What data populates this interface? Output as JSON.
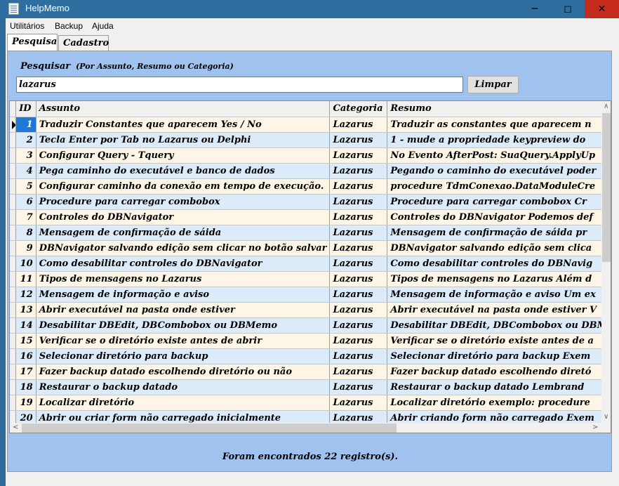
{
  "window": {
    "title": "HelpMemo"
  },
  "menu": [
    "Utilitários",
    "Backup",
    "Ajuda"
  ],
  "tabs": [
    "Pesquisa",
    "Cadastro"
  ],
  "search": {
    "label": "Pesquisar",
    "hint": "(Por Assunto, Resumo ou Categoria)",
    "value": "lazarus",
    "clear_label": "Limpar"
  },
  "grid": {
    "columns": [
      "ID",
      "Assunto",
      "Categoria",
      "Resumo"
    ],
    "rows": [
      [
        "1",
        "Traduzir Constantes que aparecem Yes / No",
        "Lazarus",
        "Traduzir as constantes que aparecem n"
      ],
      [
        "2",
        "Tecla Enter por Tab no Lazarus ou Delphi",
        "Lazarus",
        "1 -  mude a propriedade keypreview do"
      ],
      [
        "3",
        "Configurar Query - Tquery",
        "Lazarus",
        "No Evento AfterPost:  SuaQuery.ApplyUp"
      ],
      [
        "4",
        "Pega caminho do executável e banco de dados",
        "Lazarus",
        "Pegando o caminho do executável poder"
      ],
      [
        "5",
        "Configurar caminho da conexão em tempo de execução.",
        "Lazarus",
        "procedure TdmConexao.DataModuleCre"
      ],
      [
        "6",
        "Procedure para carregar combobox",
        "Lazarus",
        "Procedure para carregar combobox  Cr"
      ],
      [
        "7",
        "Controles do DBNavigator",
        "Lazarus",
        "Controles do DBNavigator  Podemos def"
      ],
      [
        "8",
        "Mensagem de confirmação de sáida",
        "Lazarus",
        "Mensagem de confirmação de sáida  pr"
      ],
      [
        "9",
        "DBNavigator salvando edição sem clicar no botão salvar",
        "Lazarus",
        "DBNavigator salvando edição sem clica"
      ],
      [
        "10",
        "Como desabilitar controles do DBNavigator",
        "Lazarus",
        "Como desabilitar controles do DBNavig"
      ],
      [
        "11",
        "Tipos de mensagens no Lazarus",
        "Lazarus",
        "Tipos de mensagens no Lazarus  Além d"
      ],
      [
        "12",
        "Mensagem de informação e aviso",
        "Lazarus",
        "Mensagem de informação e aviso  Um ex"
      ],
      [
        "13",
        "Abrir executável na pasta onde estiver",
        "Lazarus",
        "Abrir executável na pasta onde estiver V"
      ],
      [
        "14",
        "Desabilitar DBEdit, DBCombobox ou DBMemo",
        "Lazarus",
        "Desabilitar DBEdit, DBCombobox ou DBM"
      ],
      [
        "15",
        "Verificar se o diretório existe antes de abrir",
        "Lazarus",
        "Verificar se o diretório existe antes de a"
      ],
      [
        "16",
        "Selecionar diretório para backup",
        "Lazarus",
        "Selecionar diretório para backup  Exem"
      ],
      [
        "17",
        "Fazer backup datado escolhendo diretório ou não",
        "Lazarus",
        "Fazer backup datado escolhendo diretó"
      ],
      [
        "18",
        "Restaurar  o backup datado",
        "Lazarus",
        "Restaurar  o backup datado  Lembrand"
      ],
      [
        "19",
        "Localizar diretório",
        "Lazarus",
        "Localizar diretório exemplo:  procedure"
      ],
      [
        "20",
        "Abrir ou criar form não carregado inicialmente",
        "Lazarus",
        "Abrir criando form não carregado  Exem"
      ]
    ]
  },
  "status": "Foram encontrados 22 registro(s)."
}
